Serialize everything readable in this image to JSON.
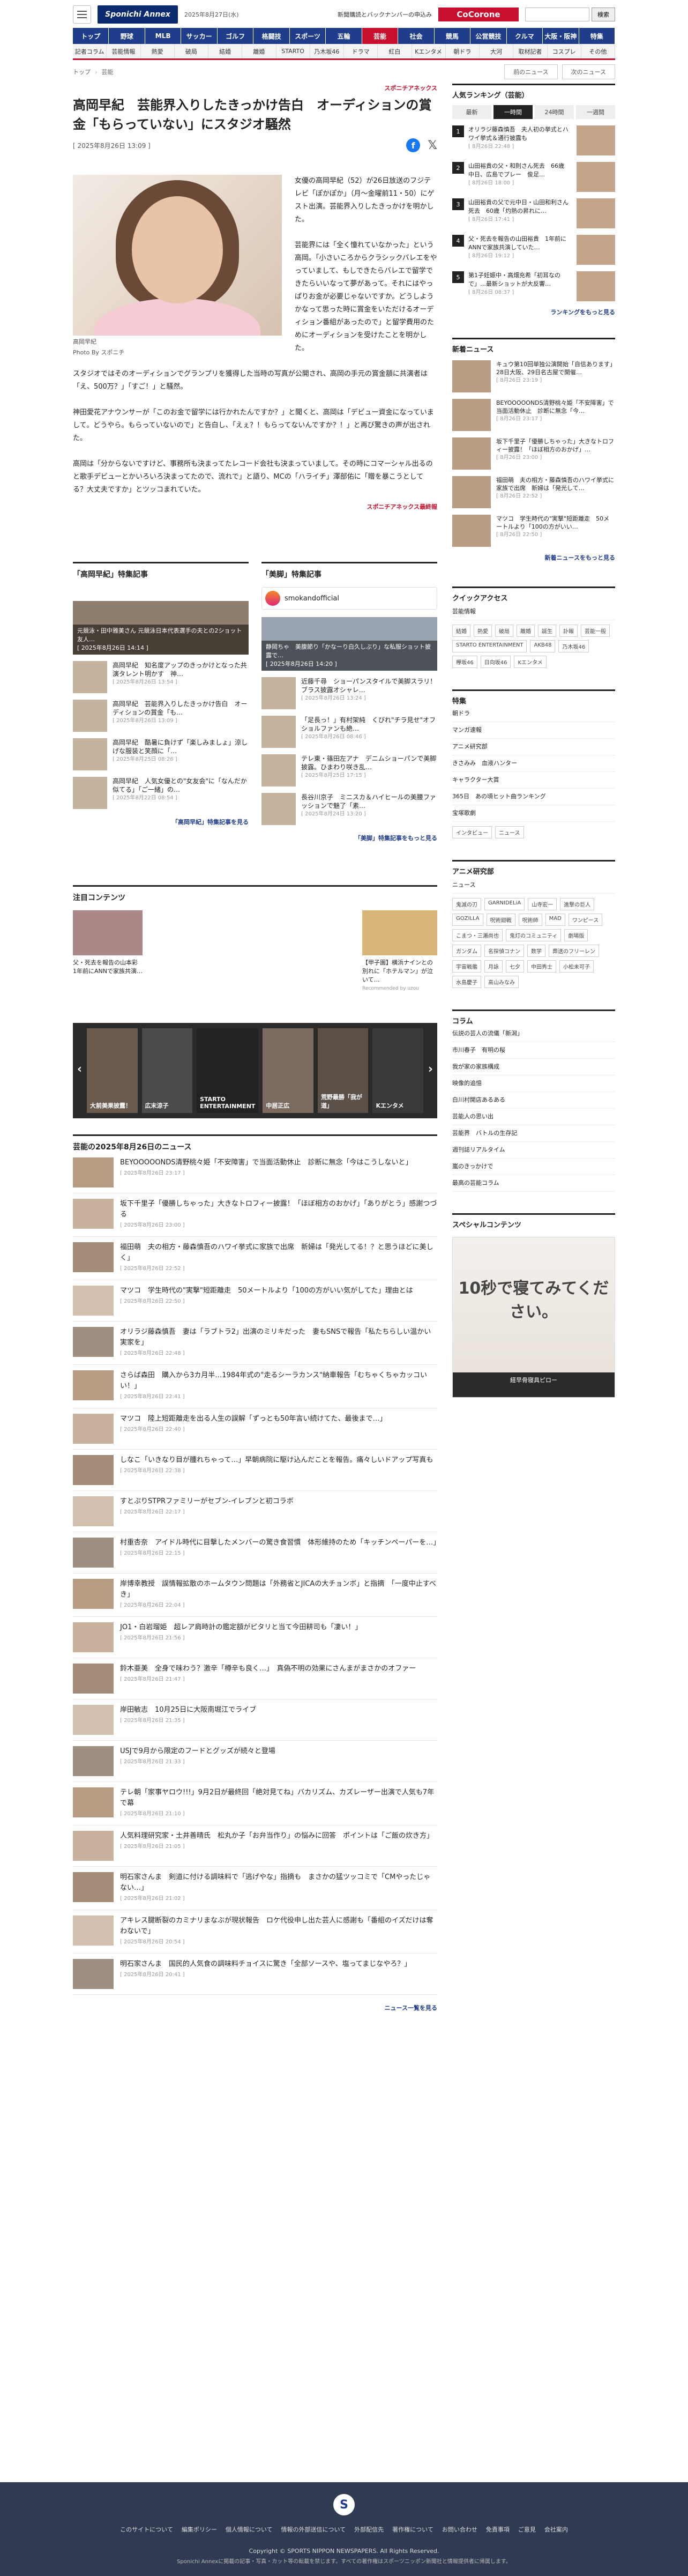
{
  "header": {
    "logo": "Sponichi Annex",
    "date": "2025年8月27日(水)",
    "backnumber": "新聞購読とバックナンバーの申込み",
    "cocorone": "CoCorone",
    "search_placeholder": "",
    "search_button": "検索"
  },
  "nav_primary": [
    "トップ",
    "野球",
    "MLB",
    "サッカー",
    "ゴルフ",
    "格闘技",
    "スポーツ",
    "五輪",
    "芸能",
    "社会",
    "競馬",
    "公営競技",
    "クルマ",
    "大阪・阪神",
    "特集"
  ],
  "nav_primary_active": 8,
  "nav_secondary": [
    "記者コラム",
    "芸能情報",
    "熱愛",
    "破局",
    "結婚",
    "離婚",
    "STARTO",
    "乃木坂46",
    "ドラマ",
    "紅白",
    "Kエンタメ",
    "朝ドラ",
    "大河",
    "取材記者",
    "コスプレ",
    "その他"
  ],
  "breadcrumb": {
    "home": "トップ",
    "section": "芸能",
    "prev": "前のニュース",
    "next": "次のニュース"
  },
  "article": {
    "source_top": "スポニチアネックス",
    "title": "高岡早紀　芸能界入りしたきっかけ告白　オーディションの賞金「もらっていない」にスタジオ騒然",
    "date": "[ 2025年8月26日 13:09 ]",
    "caption_1": "高岡早紀",
    "caption_2": "Photo By スポニチ",
    "paragraphs": [
      "女優の高岡早紀（52）が26日放送のフジテレビ「ぽかぽか」（月～金曜前11・50）にゲスト出演。芸能界入りしたきっかけを明かした。",
      "芸能界には「全く憧れていなかった」という高岡。「小さいころからクラシックバレエをやっていまして、もしできたらバレエで留学できたらいいなって夢があって。それにはやっぱりお金が必要じゃないですか。どうしようかなって思った時に賞金をいただけるオーディション番組があったので」と留学費用のためにオーディションを受けたことを明かした。",
      "スタジオではそのオーディションでグランプリを獲得した当時の写真が公開され、高岡の手元の賞金額に共演者は「え、500万？」「すご！」と騒然。",
      "神田愛花アナウンサーが「このお金で留学には行かれたんですか？」と聞くと、高岡は「デビュー資金になっていまして。どうやら。もらっていないので」と告白し、「えぇ？！もらってないんですか？！」と再び驚きの声が出された。",
      "高岡は「分からないですけど、事務所も決まってたレコード会社も決まっていまして。その時にコマーシャル出るのと歌手デビューとかいろいろ決まってたので、流れで」と語り、MCの「ハライチ」澤部佑に「贈を暴こうとしてる？大丈夫ですか」とツッコまれていた。"
    ],
    "source_bottom": "スポニチアネックス最終報"
  },
  "features": [
    {
      "heading": "「高岡早紀」特集記事",
      "hero_caption": "元競泳・田中雅美さん 元競泳日本代表選手の夫との2ショット 友人…",
      "hero_date": "[ 2025年8月26日 14:14 ]",
      "items": [
        {
          "title": "高岡早紀　知名度アップのきっかけとなった共演タレント明かす　神…",
          "date": "[ 2025年8月26日 13:54 ]"
        },
        {
          "title": "高岡早紀　芸能界入りしたきっかけ告白　オーディションの賞金「も…",
          "date": "[ 2025年8月26日 13:09 ]"
        },
        {
          "title": "高岡早紀　酷暑に負けず「楽しみましょ」涼しげな服装と笑顔に「…",
          "date": "[ 2025年8月25日 08:26 ]"
        },
        {
          "title": "高岡早紀　人気女優との\"女友会\"に「なんだか似てる」「ご一緒」の…",
          "date": "[ 2025年8月22日 08:54 ]"
        }
      ],
      "more": "「高岡早紀」特集記事を見る"
    },
    {
      "heading": "「美脚」特集記事",
      "account": "smokandofficial",
      "hero_caption": "静岡ちゃ　美腹節り「かなーり白久しぶり」な私服ショット披露で…",
      "hero_date": "[ 2025年8月26日 14:20 ]",
      "items": [
        {
          "title": "近藤千尋　ショーパンスタイルで美脚スラリ！ブラス披露オシャレ…",
          "date": "[ 2025年8月26日 13:24 ]"
        },
        {
          "title": "「足長っ！」有村架純　くびれ\"チラ見せ\"オフショルファンも絶…",
          "date": "[ 2025年8月26日 08:46 ]"
        },
        {
          "title": "テレ東・篠田左アナ　デニムショーパンで美脚披露。ひまわり咲き乱…",
          "date": "[ 2025年8月25日 17:15 ]"
        },
        {
          "title": "長谷川京子　ミニスカ＆ハイヒールの美腰ファッションで魅了「素…",
          "date": "[ 2025年8月24日 13:20 ]"
        }
      ],
      "more": "「美脚」特集記事をもっと見る"
    }
  ],
  "attention": {
    "heading": "注目コンテンツ",
    "items": [
      {
        "title": "父・死去を報告の山本彩 1年前にANNで家族共演…"
      },
      {
        "title": "【甲子園】横浜ナインとの別れに「ホテルマン」が泣いて…"
      }
    ],
    "ad_label": "Recommended by uzou"
  },
  "carousel": [
    "大前美果披露！",
    "広末涼子",
    "STARTO ENTERTAINMENT",
    "中居正広",
    "荒野最勝「我が道」",
    "Kエンタメ"
  ],
  "newslist": {
    "heading": "芸能の2025年8月26日のニュース",
    "items": [
      {
        "title": "BEYOOOOONDS清野桃々姫「不安障害」で当面活動休止　診断に無念「今はこうしないと」",
        "date": "[ 2025年8月26日 23:17 ]"
      },
      {
        "title": "坂下千里子「優勝しちゃった」大きなトロフィー披露！「ほぼ相方のおかげ」「ありがとう」感謝つづる",
        "date": "[ 2025年8月26日 23:00 ]"
      },
      {
        "title": "福田萌　夫の相方・藤森慎吾のハワイ挙式に家族で出席　新婦は「発光してる！？と思うほどに美しく」",
        "date": "[ 2025年8月26日 22:52 ]"
      },
      {
        "title": "マツコ　学生時代の\"実撃\"短距離走　50メートルより「100の方がいい気がしてた」理由とは",
        "date": "[ 2025年8月26日 22:50 ]"
      },
      {
        "title": "オリラジ藤森慎吾　妻は「ラブトラ2」出演のミリキだった　妻もSNSで報告「私たちらしい温かい実家を」",
        "date": "[ 2025年8月26日 22:48 ]"
      },
      {
        "title": "さらば森田　購入から3カ月半…1984年式の\"走るシーラカンス\"納車報告「むちゃくちゃカッコいい！」",
        "date": "[ 2025年8月26日 22:41 ]"
      },
      {
        "title": "マツコ　陸上短距離走を出る人生の誤解「ずっとも50年言い続けてた、最後まで…」",
        "date": "[ 2025年8月26日 22:40 ]"
      },
      {
        "title": "しなこ「いきなり目が腫れちゃって…」早朝病院に駆け込んだことを報告。痛々しいドアップ写真も",
        "date": "[ 2025年8月26日 22:38 ]"
      },
      {
        "title": "すとぷりSTPRファミリーがセブン-イレブンと初コラボ",
        "date": "[ 2025年8月26日 22:17 ]"
      },
      {
        "title": "村重杏奈　アイドル時代に目撃したメンバーの驚き食習慣　体形維持のため「キッチンペーパーを…」",
        "date": "[ 2025年8月26日 22:15 ]"
      },
      {
        "title": "岸博幸教授　誤情報拡散のホームタウン問題は「外務省とJICAの大チョンボ」と指摘　「一度中止すべき」",
        "date": "[ 2025年8月26日 22:04 ]"
      },
      {
        "title": "JO1・白岩瑠姫　超レア肩時計の鑑定額がピタリと当て今田耕司も「凄い！」",
        "date": "[ 2025年8月26日 21:56 ]"
      },
      {
        "title": "鈴木亜美　全身で味わう？激辛「樽辛も良く…」　真偽不明の効果にさんまがまさかのオファー",
        "date": "[ 2025年8月26日 21:47 ]"
      },
      {
        "title": "岸田敏志　10月25日に大阪南堀江でライブ",
        "date": "[ 2025年8月26日 21:35 ]"
      },
      {
        "title": "USJで9月から限定のフードとグッズが続々と登場",
        "date": "[ 2025年8月26日 21:33 ]"
      },
      {
        "title": "テレ朝「家事ヤロウ!!!」9月2日が最終回「絶対見てね」バカリズム、カズレーザー出演で人気も7年で幕",
        "date": "[ 2025年8月26日 21:10 ]"
      },
      {
        "title": "人気料理研究家・土井善晴氏　松丸か子「お弁当作り」の悩みに回答　ポイントは「ご飯の炊き方」",
        "date": "[ 2025年8月26日 21:05 ]"
      },
      {
        "title": "明石家さんま　剣道に付ける調味料で「逃げやな」指摘も　まさかの猛ツッコミで「CMやったじゃない…」",
        "date": "[ 2025年8月26日 21:02 ]"
      },
      {
        "title": "アキレス腱断裂のカミナリまなぶが現状報告　ロケ代役申し出た芸人に感謝も「番組のイズだけは奪わないで」",
        "date": "[ 2025年8月26日 20:54 ]"
      },
      {
        "title": "明石家さんま　国民的人気食の調味料チョイスに驚き「全部ソースや、塩ってまじなやろ？」",
        "date": "[ 2025年8月26日 20:41 ]"
      }
    ],
    "more": "ニュース一覧を見る"
  },
  "sidebar": {
    "ranking": {
      "heading": "人気ランキング（芸能）",
      "tabs": [
        "最新",
        "一時間",
        "24時間",
        "一週間"
      ],
      "active_tab": 1,
      "items": [
        {
          "rank": "1",
          "title": "オリラジ藤森慎吾　夫人初の挙式とハワイ挙式＆通行披露も",
          "date": "[ 8月26日 22:48 ]"
        },
        {
          "title": "山田裕貴の父・和則さん死去　66歳　中日、広島でプレー　俊足…",
          "rank": "2",
          "date": "[ 8月26日 18:00 ]"
        },
        {
          "title": "山田裕貴の父で元中日・山田和利さん死去　60歳「灼熱の昇れに…",
          "rank": "3",
          "date": "[ 8月26日 17:41 ]"
        },
        {
          "title": "父・死去を報告の山田裕貴　1年前にANNで家族共演していた…",
          "rank": "4",
          "date": "[ 8月26日 19:12 ]"
        },
        {
          "title": "第1子妊娠中・高畑充希「初耳なので」…最新ショットが大反響…",
          "rank": "5",
          "date": "[ 8月26日 08:37 ]"
        }
      ],
      "more": "ランキングをもっと見る"
    },
    "news": {
      "heading": "新着ニュース",
      "items": [
        {
          "title": "キュウ第10回単独公演開始「自信あります」28日大阪、29日名古屋で開催…",
          "date": "[ 8月26日 23:19 ]"
        },
        {
          "title": "BEYOOOOONDS清野桃々姫「不安障害」で当面活動休止　診断に無念「今…",
          "date": "[ 8月26日 23:17 ]"
        },
        {
          "title": "坂下千里子「優勝しちゃった」大きなトロフィー披露！「ほぼ相方のおかげ」…",
          "date": "[ 8月26日 23:00 ]"
        },
        {
          "title": "福田萌　夫の相方・藤森慎吾のハワイ挙式に家族で出席　新婦は「発光して…",
          "date": "[ 8月26日 22:52 ]"
        },
        {
          "title": "マツコ　学生時代の\"実撃\"短距離走　50メートルより「100の方がいい…",
          "date": "[ 8月26日 22:50 ]"
        }
      ],
      "more": "新着ニュースをもっと見る"
    },
    "quick": {
      "heading": "クイックアクセス",
      "first": "芸能情報",
      "chips": [
        "結婚",
        "熱愛",
        "破局",
        "離婚",
        "誕生",
        "訃報",
        "芸能一般",
        "STARTO ENTERTAINMENT",
        "AKB48",
        "乃木坂46",
        "欅坂46",
        "日向坂46",
        "Kエンタメ"
      ]
    },
    "special": {
      "heading": "特集",
      "items": [
        "朝ドラ",
        "マンガ速報",
        "アニメ研究部",
        "きさみみ　血液ハンター",
        "キャラクター大賞",
        "365日　あの頃ヒット曲ランキング",
        "宝塚歌劇"
      ],
      "tabs": [
        "インタビュー",
        "ニュース"
      ]
    },
    "anime": {
      "heading": "アニメ研究部",
      "first": "ニュース",
      "chips": [
        "鬼滅の刃",
        "GARNIDELiA",
        "山寺宏一",
        "進撃の巨人",
        "GOZILLA",
        "呪術廻戦",
        "呪術師",
        "MAD",
        "ワンピース",
        "こまつ・三瀬尚也",
        "鬼灯のコミュニティ",
        "劇場版",
        "ガンダム",
        "名探偵コナン",
        "数学",
        "葬送のフリーレン",
        "宇宙戦艦",
        "月詠",
        "七夕",
        "中田秀士",
        "小松未可子",
        "水島慶子",
        "高山みなみ"
      ]
    },
    "column": {
      "heading": "コラム",
      "items": [
        "伝説の芸人の流儀「新潟」",
        "市川春子　有明の桜",
        "我が家の家族構成",
        "映像的追憶",
        "白川村開店あるある",
        "芸能人の思い出",
        "芸能界　バトルの生存記",
        "週刊誌リアルタイム",
        "嵐のきっかけで",
        "最高の芸能コラム"
      ]
    },
    "special_content": {
      "heading": "スペシャルコンテンツ",
      "ad_big": "10秒で寝てみてください。",
      "ad_bottom": "経早骨寝具ピロー"
    }
  },
  "footer": {
    "links": [
      "このサイトについて",
      "編集ポリシー",
      "個人情報について",
      "情報の外部送信について",
      "外部配信先",
      "著作権について",
      "お問い合わせ",
      "免責事項",
      "ご意見",
      "会社案内"
    ],
    "copyright": "Copyright © SPORTS NIPPON NEWSPAPERS. All Rights Reserved.",
    "note": "Sponichi Annexに掲載の記事・写真・カット等の転載を禁じます。すべての著作権はスポーツニッポン新聞社と情報提供者に帰属します。"
  }
}
